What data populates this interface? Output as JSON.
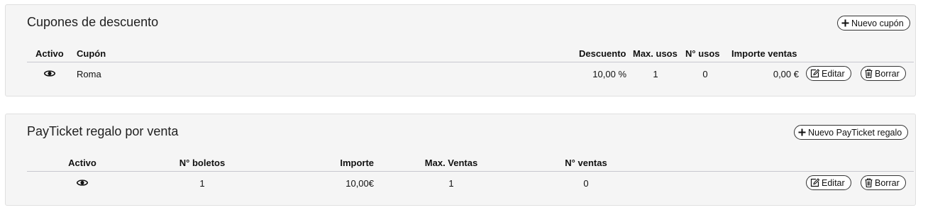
{
  "coupons": {
    "title": "Cupones de descuento",
    "new_button_label": "Nuevo cupón",
    "columns": [
      "Activo",
      "Cupón",
      "Descuento",
      "Max. usos",
      "N° usos",
      "Importe ventas"
    ],
    "rows": [
      {
        "active_icon": "eye-icon",
        "coupon": "Roma",
        "discount": "10,00 %",
        "max_uses": "1",
        "uses": "0",
        "sales_amount": "0,00 €",
        "edit_label": "Editar",
        "delete_label": "Borrar"
      }
    ]
  },
  "payticket": {
    "title": "PayTicket regalo por venta",
    "new_button_label": "Nuevo PayTicket regalo",
    "columns": [
      "Activo",
      "N° boletos",
      "Importe",
      "Max. Ventas",
      "N° ventas"
    ],
    "rows": [
      {
        "active_icon": "eye-icon",
        "tickets": "1",
        "amount": "10,00€",
        "max_sales": "1",
        "sales": "0",
        "edit_label": "Editar",
        "delete_label": "Borrar"
      }
    ]
  }
}
